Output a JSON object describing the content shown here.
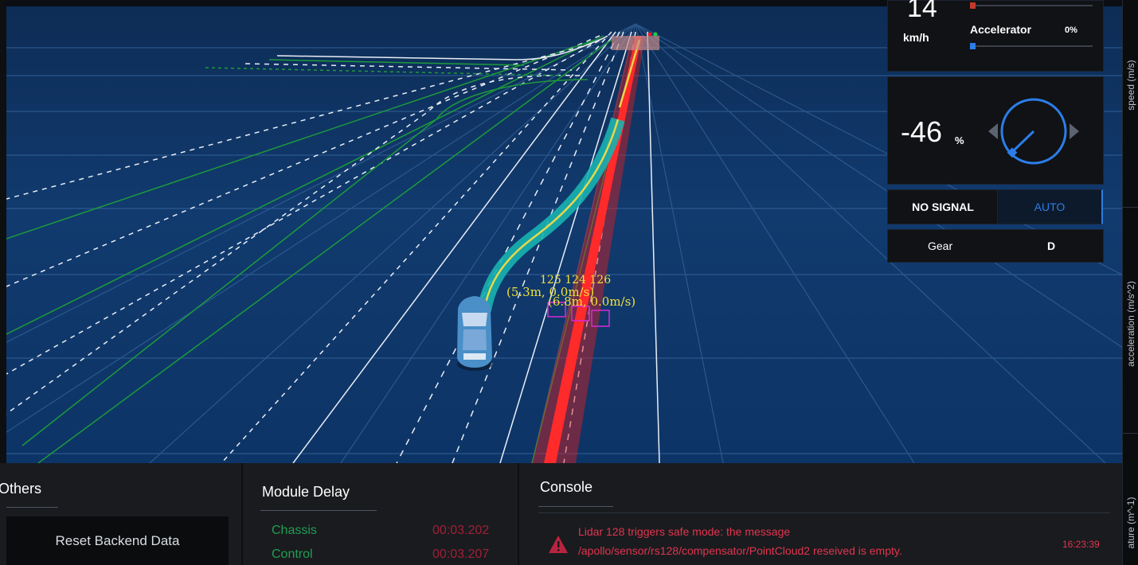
{
  "speed": {
    "value": "14",
    "unit": "km/h"
  },
  "accelerator": {
    "label": "Accelerator",
    "value": "0%"
  },
  "steering": {
    "value": "-46",
    "unit": "%"
  },
  "signal": {
    "left": "NO SIGNAL",
    "right": "AUTO"
  },
  "gear": {
    "label": "Gear",
    "value": "D"
  },
  "obstacles": {
    "ids": [
      "125",
      "124",
      "126"
    ],
    "labels": [
      "(5.3m, 0.0m/s)",
      "(6.8m, 0.0m/s)"
    ]
  },
  "rail_labels": [
    "speed (m/s)",
    "acceleration (m/s^2)",
    "ature (m^-1)"
  ],
  "others": {
    "title": "Others",
    "reset_button": "Reset Backend Data"
  },
  "module_delay": {
    "title": "Module Delay",
    "rows": [
      {
        "name": "Chassis",
        "value": "00:03.202"
      },
      {
        "name": "Control",
        "value": "00:03.207"
      }
    ]
  },
  "console": {
    "title": "Console",
    "messages": [
      {
        "line1": "Lidar 128 triggers safe mode: the message",
        "line2": "/apollo/sensor/rs128/compensator/PointCloud2 reseived is empty.",
        "time": "16:23:39"
      }
    ]
  },
  "colors": {
    "scene_bg": "#113a6e",
    "trajectory": "#18b3b0",
    "reference_line": "#e02020",
    "accent_blue": "#2c7de8",
    "delay_ok": "#1f9e54",
    "delay_value": "#a01f3a",
    "console_error": "#e0354f"
  }
}
